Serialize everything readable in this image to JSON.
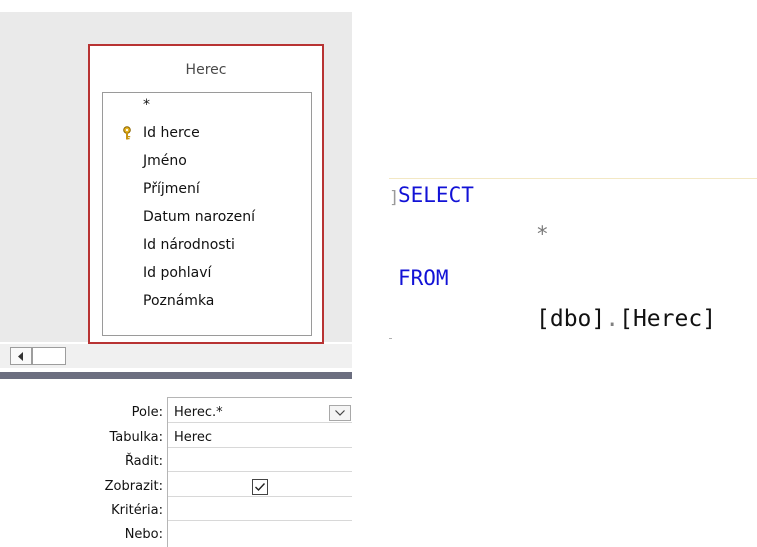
{
  "designer": {
    "table": {
      "name": "Herec",
      "fields": [
        "*",
        "Id herce",
        "Jméno",
        "Příjmení",
        "Datum narození",
        "Id národnosti",
        "Id pohlaví",
        "Poznámka"
      ],
      "primary_key_field": "Id herce"
    },
    "grid": {
      "rows": [
        {
          "label": "Pole:",
          "value": "Herec.*"
        },
        {
          "label": "Tabulka:",
          "value": "Herec"
        },
        {
          "label": "Řadit:",
          "value": ""
        },
        {
          "label": "Zobrazit:",
          "value": ""
        },
        {
          "label": "Kritéria:",
          "value": ""
        },
        {
          "label": "Nebo:",
          "value": ""
        }
      ],
      "show_checked": true
    },
    "icons": [
      "key-icon",
      "chevron-down-icon",
      "scroll-left-icon",
      "checkmark-icon"
    ]
  },
  "sql": {
    "select": "SELECT",
    "star": "*",
    "from": "FROM",
    "schema": "[dbo]",
    "dot": ".",
    "table": "[Herec]"
  },
  "colors": {
    "keyword": "#1212d6",
    "table_border": "#b83333",
    "splitter": "#6b6e7f"
  }
}
